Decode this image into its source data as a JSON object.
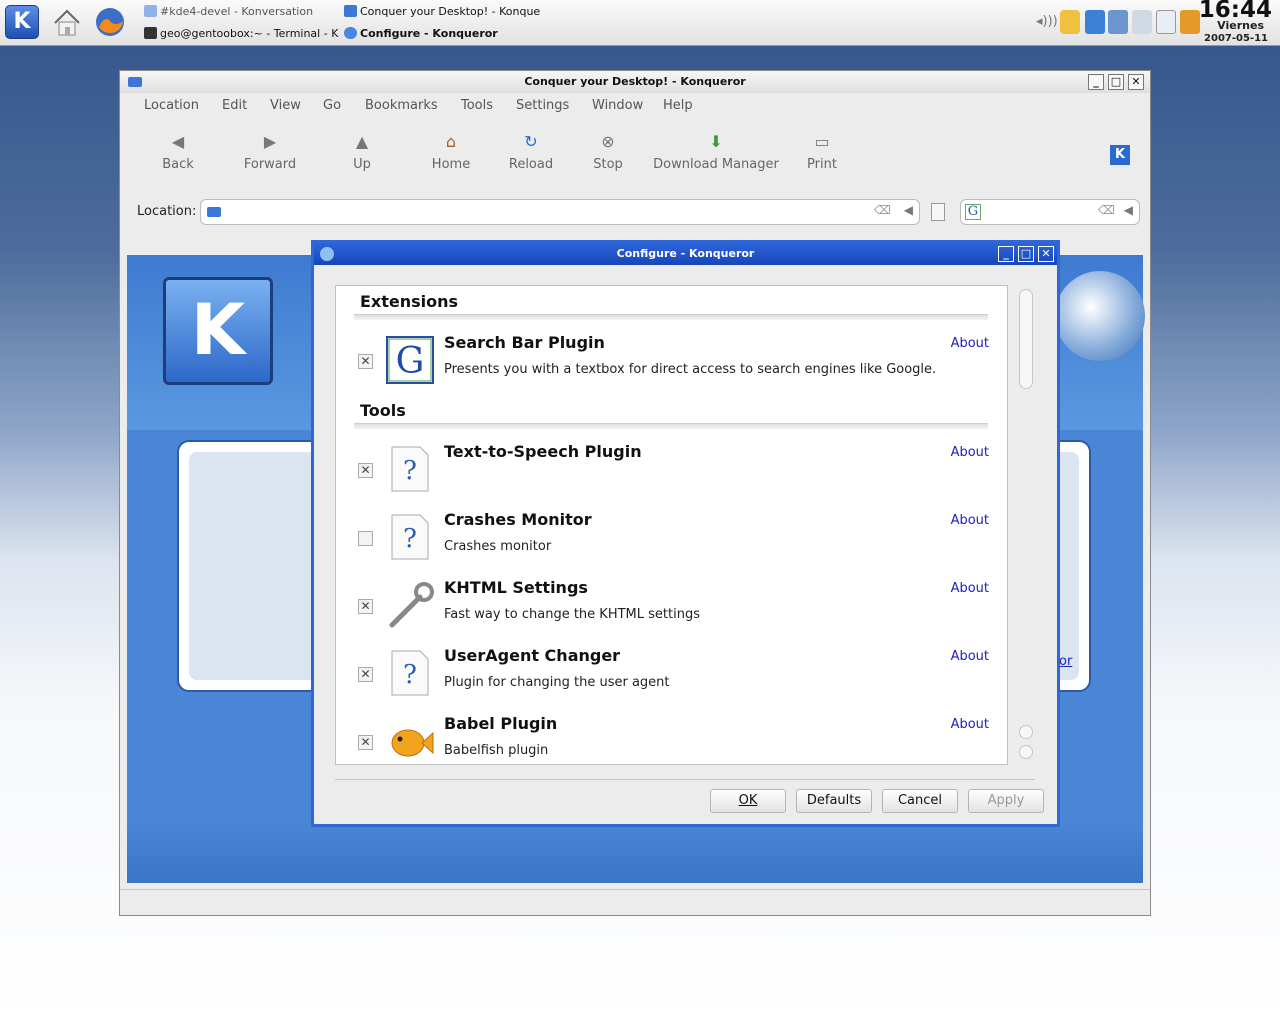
{
  "taskbar": {
    "tasks": [
      {
        "label": "#kde4-devel - Konversation",
        "active": false
      },
      {
        "label": "Conquer your Desktop! - Konqueror",
        "active": false
      },
      {
        "label": "geo@gentoobox:~ - Terminal - Konsole",
        "active": false
      },
      {
        "label": "Configure - Konqueror",
        "active": true
      }
    ],
    "clock": {
      "time": "16:44",
      "day": "Viernes",
      "date": "2007-05-11"
    }
  },
  "konqueror": {
    "title": "Conquer your Desktop! - Konqueror",
    "menu": [
      "Location",
      "Edit",
      "View",
      "Go",
      "Bookmarks",
      "Tools",
      "Settings",
      "Window",
      "Help"
    ],
    "toolbar": {
      "back": "Back",
      "forward": "Forward",
      "up": "Up",
      "home": "Home",
      "reload": "Reload",
      "stop": "Stop",
      "download": "Download Manager",
      "print": "Print"
    },
    "location_label": "Location:",
    "location_value": "",
    "search_value": "",
    "page_link_fragment": "or"
  },
  "dialog": {
    "title": "Configure - Konqueror",
    "sections": [
      {
        "name": "Extensions",
        "plugins": [
          {
            "name": "Search Bar Plugin",
            "desc": "Presents you with a textbox for direct access to search engines like Google.",
            "enabled": true,
            "about": "About",
            "icon": "google-g-icon"
          }
        ]
      },
      {
        "name": "Tools",
        "plugins": [
          {
            "name": "Text-to-Speech Plugin",
            "desc": "",
            "enabled": true,
            "about": "About",
            "icon": "unknown-document-icon"
          },
          {
            "name": "Crashes Monitor",
            "desc": "Crashes monitor",
            "enabled": false,
            "about": "About",
            "icon": "unknown-document-icon"
          },
          {
            "name": "KHTML Settings",
            "desc": "Fast way to change the KHTML settings",
            "enabled": true,
            "about": "About",
            "icon": "wrench-icon"
          },
          {
            "name": "UserAgent Changer",
            "desc": "Plugin for changing the user agent",
            "enabled": true,
            "about": "About",
            "icon": "unknown-document-icon"
          },
          {
            "name": "Babel Plugin",
            "desc": "Babelfish plugin",
            "enabled": true,
            "about": "About",
            "icon": "babelfish-icon"
          }
        ]
      }
    ],
    "buttons": {
      "ok": "OK",
      "defaults": "Defaults",
      "cancel": "Cancel",
      "apply": "Apply"
    }
  },
  "colors": {
    "dialog_title": "#2e64da",
    "link": "#2020c0",
    "desktop": "#33538a"
  }
}
